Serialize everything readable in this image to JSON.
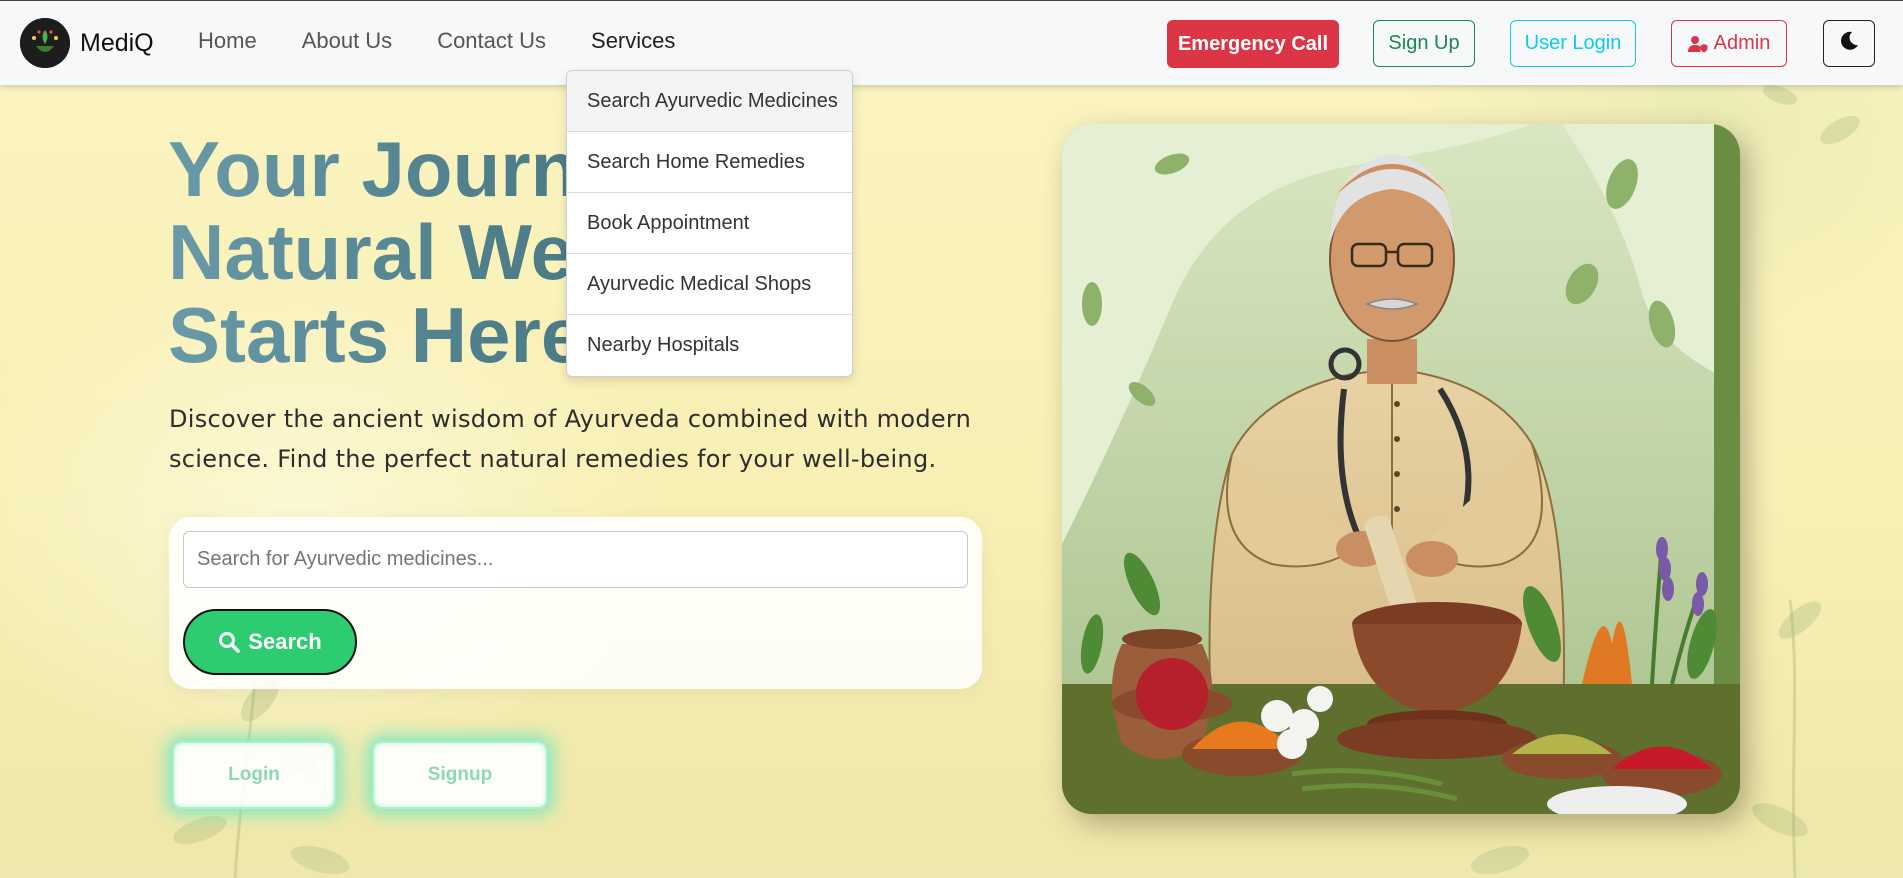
{
  "brand": {
    "name": "MediQ",
    "logo_icon": "mortar-leaf-logo"
  },
  "nav": {
    "links": [
      {
        "label": "Home"
      },
      {
        "label": "About Us"
      },
      {
        "label": "Contact Us"
      },
      {
        "label": "Services"
      }
    ],
    "active": "Services"
  },
  "actions": {
    "emergency": "Emergency Call",
    "signup": "Sign Up",
    "user_login": "User Login",
    "admin": "Admin",
    "admin_icon": "user-shield-icon",
    "theme_icon": "moon-icon"
  },
  "services_dropdown": {
    "items": [
      {
        "label": "Search Ayurvedic Medicines"
      },
      {
        "label": "Search Home Remedies"
      },
      {
        "label": "Book Appointment"
      },
      {
        "label": "Ayurvedic Medical Shops"
      },
      {
        "label": "Nearby Hospitals"
      }
    ]
  },
  "hero": {
    "title_lines": [
      "Your Journey to",
      "Natural Wellness",
      "Starts Here"
    ],
    "description": "Discover the ancient wisdom of Ayurveda combined with modern science. Find the perfect natural remedies for your well-being.",
    "search": {
      "placeholder": "Search for Ayurvedic medicines...",
      "button_label": "Search",
      "button_icon": "search-icon"
    },
    "login_label": "Login",
    "signup_label": "Signup",
    "image_subject": "ayurvedic-doctor-illustration"
  },
  "colors": {
    "emergency": "#dc3545",
    "signup": "#198754",
    "user_login": "#0dcaf0",
    "admin": "#dc3545",
    "search_button": "#2ecc71",
    "background": "#fbf4c2",
    "title_gradient": "#4f7f8b"
  }
}
